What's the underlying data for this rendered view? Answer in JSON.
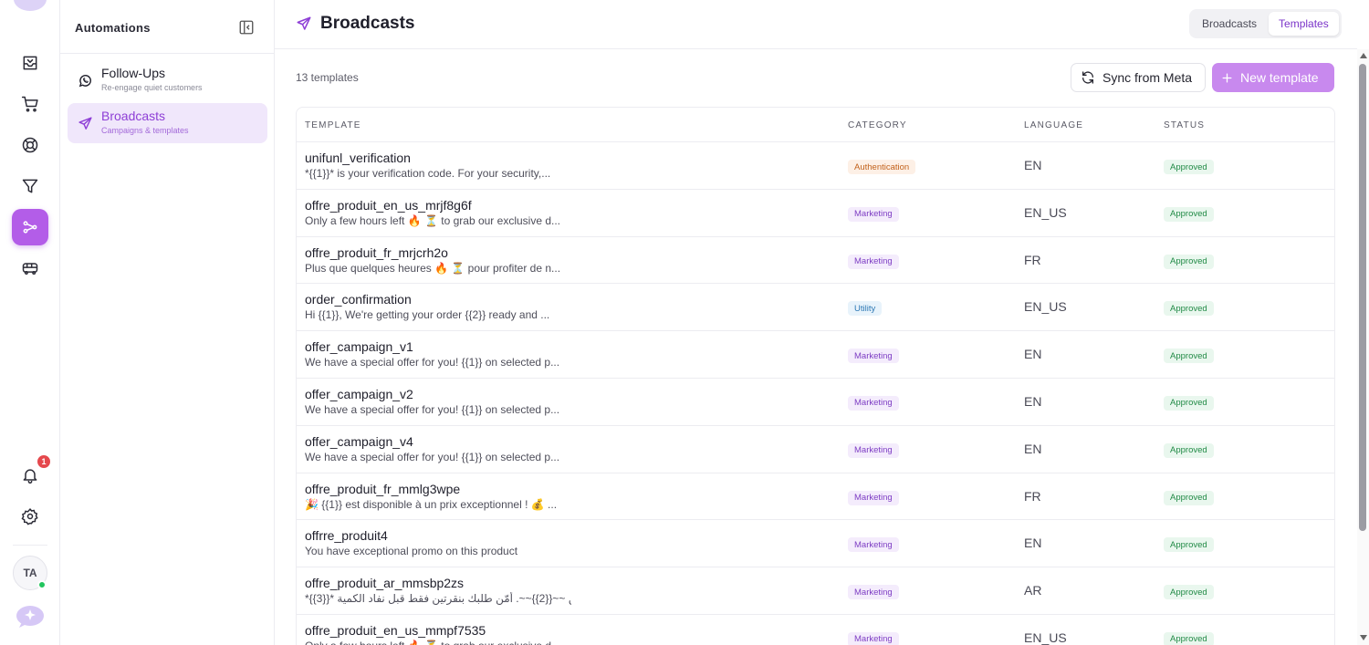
{
  "sidebar": {
    "title": "Automations",
    "items": [
      {
        "label": "Follow-Ups",
        "sub": "Re-engage quiet customers"
      },
      {
        "label": "Broadcasts",
        "sub": "Campaigns & templates"
      }
    ]
  },
  "rail": {
    "notification_count": "1",
    "avatar_initials": "TA"
  },
  "header": {
    "title": "Broadcasts",
    "segments": [
      "Broadcasts",
      "Templates"
    ],
    "active_segment": "Templates"
  },
  "toolbar": {
    "count_label": "13 templates",
    "sync_label": "Sync from Meta",
    "new_label": "New template"
  },
  "table": {
    "columns": [
      "TEMPLATE",
      "CATEGORY",
      "LANGUAGE",
      "STATUS"
    ],
    "rows": [
      {
        "name": "unifunl_verification",
        "body": "*{{1}}* is your verification code. For your security,...",
        "category": "Authentication",
        "language": "EN",
        "status": "Approved"
      },
      {
        "name": "offre_produit_en_us_mrjf8g6f",
        "body": "Only a few hours left 🔥 ⏳ to grab our exclusive d...",
        "category": "Marketing",
        "language": "EN_US",
        "status": "Approved"
      },
      {
        "name": "offre_produit_fr_mrjcrh2o",
        "body": "Plus que quelques heures 🔥 ⏳ pour profiter de n...",
        "category": "Marketing",
        "language": "FR",
        "status": "Approved"
      },
      {
        "name": "order_confirmation",
        "body": "Hi {{1}}, We're getting your order {{2}} ready and ...",
        "category": "Utility",
        "language": "EN_US",
        "status": "Approved"
      },
      {
        "name": "offer_campaign_v1",
        "body": "We have a special offer for you! {{1}} on selected p...",
        "category": "Marketing",
        "language": "EN",
        "status": "Approved"
      },
      {
        "name": "offer_campaign_v2",
        "body": "We have a special offer for you! {{1}} on selected p...",
        "category": "Marketing",
        "language": "EN",
        "status": "Approved"
      },
      {
        "name": "offer_campaign_v4",
        "body": "We have a special offer for you! {{1}} on selected p...",
        "category": "Marketing",
        "language": "EN",
        "status": "Approved"
      },
      {
        "name": "offre_produit_fr_mmlg3wpe",
        "body": "🎉 {{1}} est disponible à un prix exceptionnel ! 💰 ...",
        "category": "Marketing",
        "language": "FR",
        "status": "Approved"
      },
      {
        "name": "offrre_produit4",
        "body": "You have exceptional promo on this product",
        "category": "Marketing",
        "language": "EN",
        "status": "Approved"
      },
      {
        "name": "offre_produit_ar_mmsbp2zs",
        "body": "*{{3}}* بدلاً من ~~{{2}}~~. أمّن طلبك بنقرتين فقط قبل نفاد الكمية...",
        "category": "Marketing",
        "language": "AR",
        "status": "Approved"
      },
      {
        "name": "offre_produit_en_us_mmpf7535",
        "body": "Only a few hours left 🔥 ⏳ to grab our exclusive d...",
        "category": "Marketing",
        "language": "EN_US",
        "status": "Approved"
      }
    ]
  },
  "colors": {
    "accent": "#b35de8",
    "primary_button": "#c889ee",
    "status_approved": "#218a46"
  },
  "icons": {
    "rail": [
      "inbox-icon",
      "cart-icon",
      "support-icon",
      "filter-icon",
      "automation-icon",
      "bus-icon",
      "bell-icon",
      "gear-icon",
      "chat-icon"
    ],
    "header": "send-icon",
    "sync": "refresh-icon",
    "new": "plus-icon"
  }
}
